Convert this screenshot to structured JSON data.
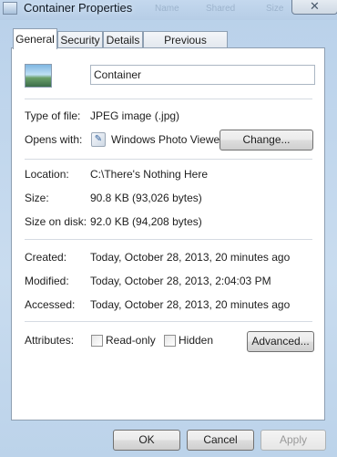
{
  "window": {
    "title": "Container Properties",
    "background_words": [
      "Name",
      "Shared",
      "Size"
    ],
    "close_glyph": "✕"
  },
  "tabs": [
    {
      "label": "General",
      "active": true
    },
    {
      "label": "Security"
    },
    {
      "label": "Details"
    },
    {
      "label": "Previous Versions"
    }
  ],
  "general": {
    "file_name": "Container",
    "type_label": "Type of file:",
    "type_value": "JPEG image (.jpg)",
    "opens_label": "Opens with:",
    "opens_value": "Windows Photo Viewer",
    "change_button": "Change...",
    "location_label": "Location:",
    "location_value": "C:\\There's Nothing Here",
    "size_label": "Size:",
    "size_value": "90.8 KB (93,026 bytes)",
    "size_on_disk_label": "Size on disk:",
    "size_on_disk_value": "92.0 KB (94,208 bytes)",
    "created_label": "Created:",
    "created_value": "Today, October 28, 2013, 20 minutes ago",
    "modified_label": "Modified:",
    "modified_value": "Today, October 28, 2013, 2:04:03 PM",
    "accessed_label": "Accessed:",
    "accessed_value": "Today, October 28, 2013, 20 minutes ago",
    "attributes_label": "Attributes:",
    "readonly_label": "Read-only",
    "readonly_checked": false,
    "hidden_label": "Hidden",
    "hidden_checked": false,
    "advanced_button": "Advanced..."
  },
  "footer": {
    "ok": "OK",
    "cancel": "Cancel",
    "apply": "Apply",
    "apply_enabled": false
  },
  "icons": {
    "title": "image-file-icon",
    "thumbnail": "jpeg-thumbnail-icon",
    "app": "photo-viewer-icon"
  },
  "colors": {
    "window_chrome": "#b9d1ea",
    "panel": "#ffffff",
    "border": "#8e9fb2"
  }
}
